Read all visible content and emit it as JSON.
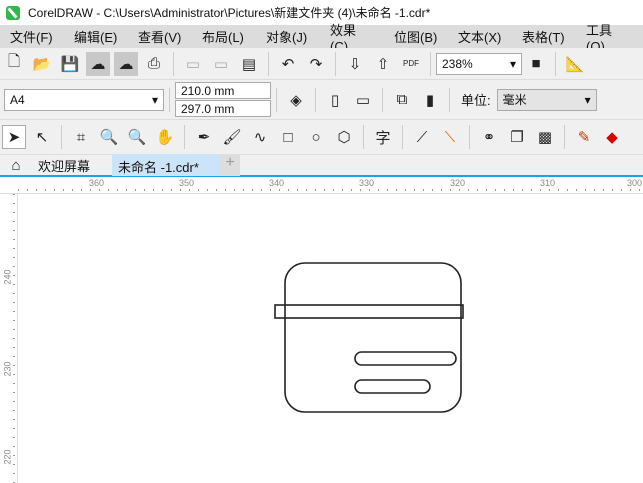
{
  "title": "CorelDRAW - C:\\Users\\Administrator\\Pictures\\新建文件夹 (4)\\未命名 -1.cdr*",
  "menu": [
    "文件(F)",
    "编辑(E)",
    "查看(V)",
    "布局(L)",
    "对象(J)",
    "效果(C)",
    "位图(B)",
    "文本(X)",
    "表格(T)",
    "工具(O)"
  ],
  "toolbar": {
    "zoom": "238%",
    "pdf_label": "PDF"
  },
  "property_bar": {
    "page_size": "A4",
    "width": "210.0 mm",
    "height": "297.0 mm",
    "units_label": "单位:",
    "units": "毫米"
  },
  "tabs": {
    "welcome": "欢迎屏幕",
    "document": "未命名 -1.cdr*",
    "add": "+"
  },
  "text_tool_glyph": "字",
  "ruler_top": [
    "360",
    "350",
    "340",
    "330",
    "320",
    "310",
    "300"
  ],
  "ruler_left": [
    "240",
    "230",
    "220"
  ]
}
